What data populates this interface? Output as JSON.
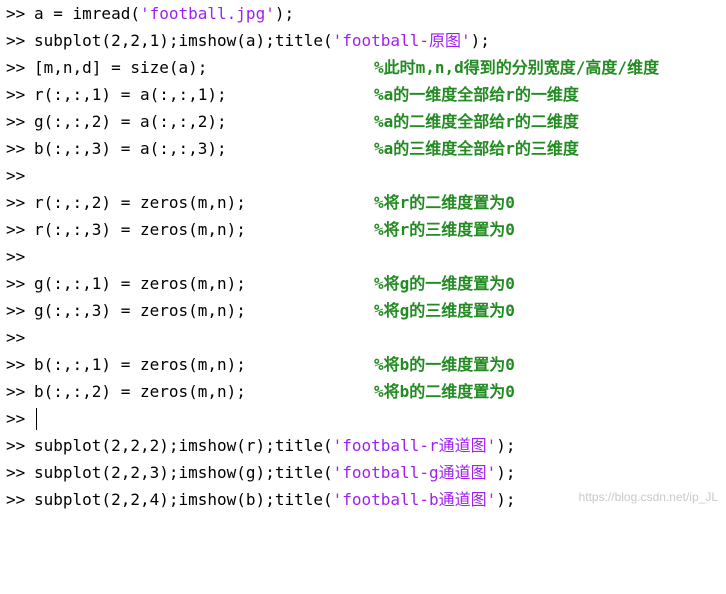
{
  "prompt": ">>",
  "lines": [
    {
      "pre": "a = imread(",
      "str": "'football.jpg'",
      "post": ");",
      "comment": ""
    },
    {
      "pre": "subplot(2,2,1);imshow(a);title(",
      "str": "'football-原图'",
      "post": ");",
      "comment": ""
    },
    {
      "pre": "[m,n,d] = size(a);",
      "str": "",
      "post": "",
      "comment": "%此时m,n,d得到的分别宽度/高度/维度"
    },
    {
      "pre": "r(:,:,1) = a(:,:,1);",
      "str": "",
      "post": "",
      "comment": "%a的一维度全部给r的一维度"
    },
    {
      "pre": "g(:,:,2) = a(:,:,2);",
      "str": "",
      "post": "",
      "comment": "%a的二维度全部给r的二维度"
    },
    {
      "pre": "b(:,:,3) = a(:,:,3);",
      "str": "",
      "post": "",
      "comment": "%a的三维度全部给r的三维度"
    },
    {
      "pre": "",
      "str": "",
      "post": "",
      "comment": ""
    },
    {
      "pre": "r(:,:,2) = zeros(m,n);",
      "str": "",
      "post": "",
      "comment": "%将r的二维度置为0"
    },
    {
      "pre": "r(:,:,3) = zeros(m,n);",
      "str": "",
      "post": "",
      "comment": "%将r的三维度置为0"
    },
    {
      "pre": "",
      "str": "",
      "post": "",
      "comment": ""
    },
    {
      "pre": "g(:,:,1) = zeros(m,n);",
      "str": "",
      "post": "",
      "comment": "%将g的一维度置为0"
    },
    {
      "pre": "g(:,:,3) = zeros(m,n);",
      "str": "",
      "post": "",
      "comment": "%将g的三维度置为0"
    },
    {
      "pre": "",
      "str": "",
      "post": "",
      "comment": ""
    },
    {
      "pre": "b(:,:,1) = zeros(m,n);",
      "str": "",
      "post": "",
      "comment": "%将b的一维度置为0"
    },
    {
      "pre": "b(:,:,2) = zeros(m,n);",
      "str": "",
      "post": "",
      "comment": "%将b的二维度置为0"
    },
    {
      "pre": "",
      "str": "",
      "post": "",
      "comment": ""
    },
    {
      "pre": "subplot(2,2,2);imshow(r);title(",
      "str": "'football-r通道图'",
      "post": ");",
      "comment": ""
    },
    {
      "pre": "subplot(2,2,3);imshow(g);title(",
      "str": "'football-g通道图'",
      "post": ");",
      "comment": ""
    },
    {
      "pre": "subplot(2,2,4);imshow(b);title(",
      "str": "'football-b通道图'",
      "post": ");",
      "comment": ""
    }
  ],
  "caret_line_number": 16,
  "watermark": "https://blog.csdn.net/ip_JL",
  "colors": {
    "code": "#000000",
    "string": "#a020f0",
    "comment": "#228b22",
    "background": "#ffffff"
  }
}
